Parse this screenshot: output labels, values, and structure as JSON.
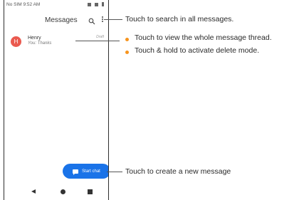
{
  "status_bar": {
    "left_text": "No SIM  9:52 AM"
  },
  "app_bar": {
    "title": "Messages",
    "search_icon": "search-icon",
    "menu_icon": "more-vert-icon"
  },
  "conversation": {
    "avatar_letter": "H",
    "avatar_color": "#ea5a4f",
    "name": "Henry",
    "snippet": "You: Thanks",
    "status": "Draft"
  },
  "fab": {
    "label": "Start chat",
    "color": "#1a73e8"
  },
  "annotations": {
    "search": "Touch to search in all messages.",
    "thread_bullets": [
      "Touch to view the whole message thread.",
      "Touch & hold to activate delete mode."
    ],
    "new_message": "Touch to create a new message"
  },
  "colors": {
    "bullet": "#f7941d",
    "accent": "#1a73e8"
  }
}
